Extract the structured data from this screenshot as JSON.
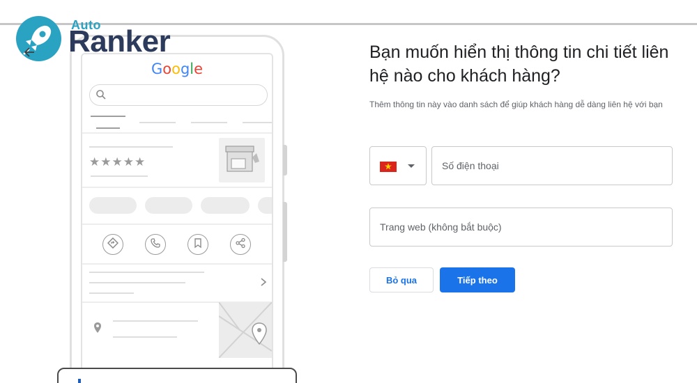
{
  "logo": {
    "top_word": "Auto",
    "main_word": "Ranker",
    "colors": {
      "accent": "#2aa2c1",
      "dark": "#2c3a5b"
    }
  },
  "preview": {
    "brand": "Google",
    "stars": "★★★★★",
    "icons": [
      "search-icon",
      "directions-icon",
      "phone-icon",
      "bookmark-icon",
      "share-icon",
      "chevron-right-icon",
      "location-pin-icon",
      "store-icon"
    ]
  },
  "form": {
    "heading": "Bạn muốn hiển thị thông tin chi tiết liên hệ nào cho khách hàng?",
    "subtext": "Thêm thông tin này vào danh sách để giúp khách hàng dễ dàng liên hệ với bạn",
    "country_flag": "vietnam-flag",
    "phone_placeholder": "Số điện thoại",
    "website_placeholder": "Trang web (không bắt buộc)",
    "skip_label": "Bỏ qua",
    "next_label": "Tiếp theo",
    "colors": {
      "primary": "#1a73e8"
    }
  }
}
